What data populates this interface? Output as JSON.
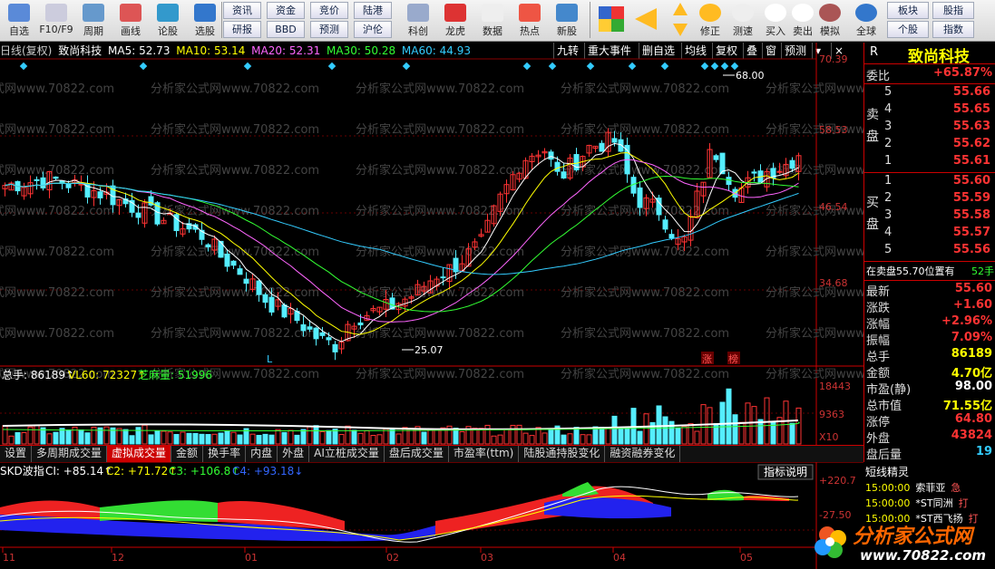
{
  "toolbar": {
    "left": [
      "自选",
      "F10/F9",
      "周期",
      "画线",
      "论股",
      "选股"
    ],
    "btns_top": [
      "资讯",
      "资金",
      "竞价",
      "陆港"
    ],
    "btns_bottom": [
      "研报",
      "BBD",
      "预测",
      "沪伦"
    ],
    "mid": [
      "科创",
      "龙虎",
      "数据",
      "热点",
      "新股"
    ],
    "right": [
      "修正",
      "测速",
      "买入",
      "卖出",
      "模拟",
      "全球"
    ],
    "small_top": [
      "板块",
      "股指"
    ],
    "small_bottom": [
      "个股",
      "指数"
    ]
  },
  "title": {
    "period": "日线(复权)",
    "name": "致尚科技",
    "ma5": "MA5: 52.73",
    "ma10": "MA10: 53.14",
    "ma20": "MA20: 52.31",
    "ma30": "MA30: 50.28",
    "ma60": "MA60: 44.93"
  },
  "chart_tools": [
    "九转",
    "重大事件",
    "删自选",
    "均线",
    "复权",
    "叠",
    "窗",
    "预测",
    "▾",
    "×"
  ],
  "price_axis": [
    "70.39",
    "58.53",
    "46.54",
    "34.68"
  ],
  "price_chart": {
    "high_label": "68.00",
    "low_label": "25.07",
    "marker_l": "L",
    "marker_zhang": "涨",
    "marker_bang": "榜",
    "watermark": "分析家公式网www.70822.com"
  },
  "volume": {
    "total": "总手: 86189↑",
    "vl60": "VL60: 72327↑",
    "zhima": "芝麻量: 51996",
    "axis": [
      "18443",
      "9363",
      "X10"
    ]
  },
  "tabs": [
    "设置",
    "多周期成交量",
    "虚拟成交量",
    "金额",
    "换手率",
    "内盘",
    "外盘",
    "AI立桩成交量",
    "盘后成交量",
    "市盈率(ttm)",
    "陆股通持股变化",
    "融资融券变化"
  ],
  "active_tab": "虚拟成交量",
  "indicator": {
    "name": "SKD波指",
    "ci": "CI: +85.14↑",
    "c2": "C2: +71.72↑",
    "c3": "C3: +106.8↑",
    "c4": "C4: +93.18↓",
    "btn": "指标说明",
    "axis": [
      "+220.7",
      "-27.50"
    ]
  },
  "x_axis": [
    "11",
    "12",
    "01",
    "02",
    "03",
    "04",
    "05"
  ],
  "quote": {
    "code": "R",
    "name": "致尚科技",
    "wb_k": "委比",
    "wb_v": "+65.87%",
    "sell_label": "卖盘",
    "buy_label": "买盘",
    "sell": [
      [
        "5",
        "55.66"
      ],
      [
        "4",
        "55.65"
      ],
      [
        "3",
        "55.63"
      ],
      [
        "2",
        "55.62"
      ],
      [
        "1",
        "55.61"
      ]
    ],
    "buy": [
      [
        "1",
        "55.60"
      ],
      [
        "2",
        "55.59"
      ],
      [
        "3",
        "55.58"
      ],
      [
        "4",
        "55.57"
      ],
      [
        "5",
        "55.56"
      ]
    ],
    "note": "在卖盘55.70位置有",
    "note_v": "52手",
    "stats": [
      [
        "最新",
        "55.60"
      ],
      [
        "涨跌",
        "+1.60"
      ],
      [
        "涨幅",
        "+2.96%"
      ],
      [
        "振幅",
        "7.09%"
      ],
      [
        "总手",
        "86189"
      ],
      [
        "金额",
        "4.70亿"
      ],
      [
        "市盈(静)",
        "98.00"
      ],
      [
        "总市值",
        "71.55亿"
      ],
      [
        "涨停",
        "64.80"
      ],
      [
        "外盘",
        "43824"
      ],
      [
        "盘后量",
        "19"
      ]
    ]
  },
  "news": {
    "title": "短线精灵",
    "rows": [
      [
        "15:00:00",
        "索菲亚",
        "急"
      ],
      [
        "15:00:00",
        "*ST同洲",
        "打"
      ],
      [
        "15:00:00",
        "*ST西飞扬",
        "打"
      ]
    ]
  },
  "logo": {
    "text": "分析家公式网",
    "url": "www.70822.com"
  }
}
